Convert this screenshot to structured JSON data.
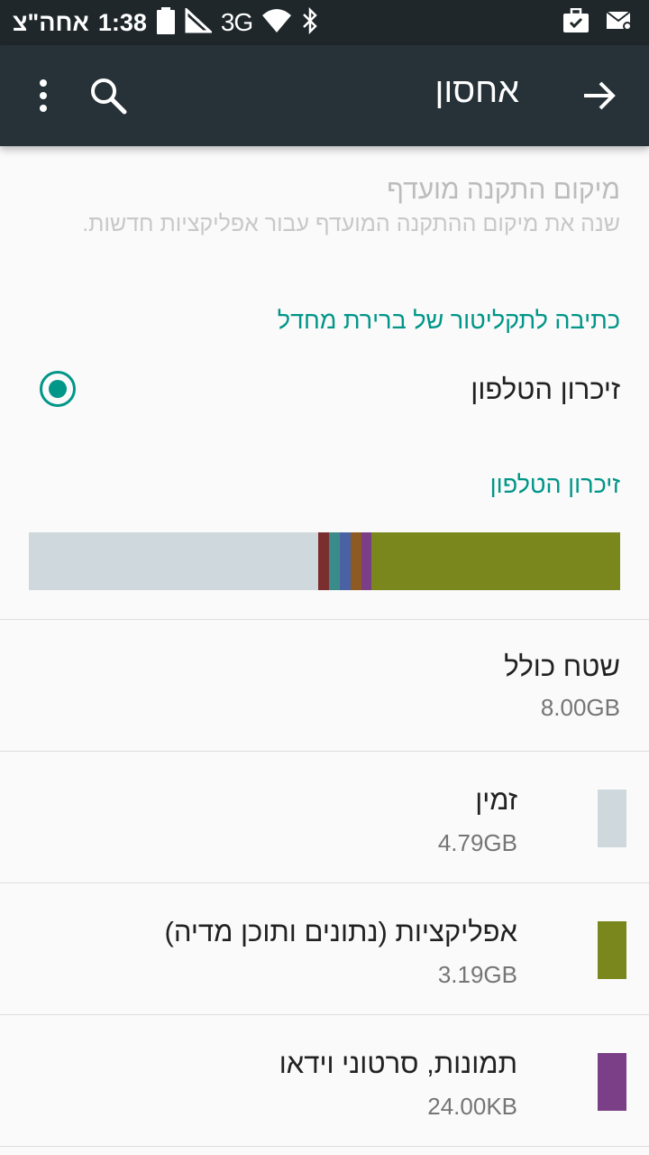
{
  "status_bar": {
    "time": "1:38",
    "period": "אחה\"צ",
    "network": "3G",
    "icons": [
      "battery-icon",
      "signal-icon",
      "wifi-icon",
      "bluetooth-icon",
      "briefcase-check-icon",
      "mail-settings-icon"
    ]
  },
  "toolbar": {
    "title": "אחסון",
    "icons": [
      "back-arrow-icon",
      "search-icon",
      "more-vert-icon"
    ]
  },
  "preferred_install": {
    "title": "מיקום התקנה מועדף",
    "summary": "שנה את מיקום ההתקנה המועדף עבור אפליקציות חדשות."
  },
  "write_section": {
    "header": "כתיבה לתקליטור של ברירת מחדל",
    "option_label": "זיכרון הטלפון",
    "selected": true
  },
  "phone_storage": {
    "header": "זיכרון הטלפון",
    "usage_bar": [
      {
        "name": "available",
        "fraction": 0.49,
        "color": "#cfd8dc"
      },
      {
        "name": "misc-1",
        "fraction": 0.018,
        "color": "#7b2e2e"
      },
      {
        "name": "misc-2",
        "fraction": 0.018,
        "color": "#3b8b8b"
      },
      {
        "name": "misc-3",
        "fraction": 0.018,
        "color": "#4a62a3"
      },
      {
        "name": "misc-4",
        "fraction": 0.018,
        "color": "#8c5a22"
      },
      {
        "name": "pictures",
        "fraction": 0.018,
        "color": "#7b3f88"
      },
      {
        "name": "apps",
        "fraction": 0.42,
        "color": "#7a871d"
      }
    ],
    "total": {
      "title": "שטח כולל",
      "value": "8.00GB"
    },
    "items": [
      {
        "title": "זמין",
        "value": "4.79GB",
        "color": "#cfd8dc"
      },
      {
        "title": "אפליקציות (נתונים ותוכן מדיה)",
        "value": "3.19GB",
        "color": "#7a871d"
      },
      {
        "title": "תמונות, סרטוני וידאו",
        "value": "24.00KB",
        "color": "#7b3f88"
      }
    ]
  }
}
